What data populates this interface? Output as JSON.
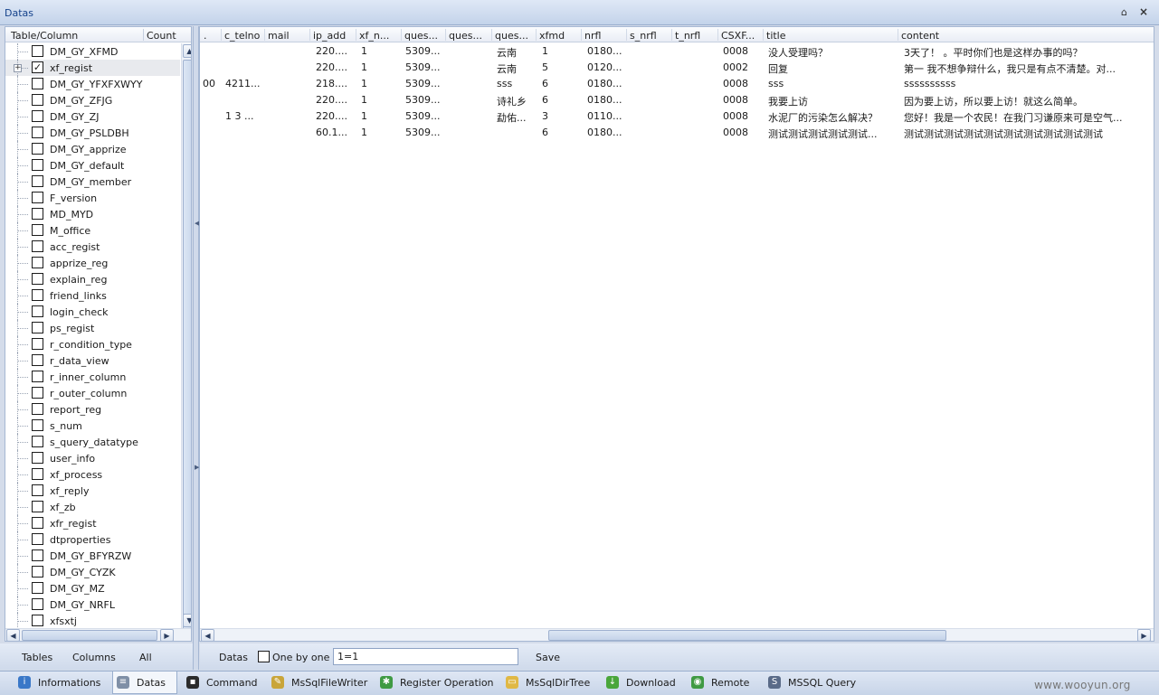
{
  "window": {
    "title": "Datas",
    "pin_glyph": "⌂",
    "close_glyph": "×"
  },
  "left_panel": {
    "headers": {
      "table_column": "Table/Column",
      "count": "Count"
    },
    "items": [
      {
        "label": "DM_GY_XFMD",
        "checked": false
      },
      {
        "label": "xf_regist",
        "checked": true,
        "expandable": true,
        "selected": true
      },
      {
        "label": "DM_GY_YFXFXWYY",
        "checked": false
      },
      {
        "label": "DM_GY_ZFJG",
        "checked": false
      },
      {
        "label": "DM_GY_ZJ",
        "checked": false
      },
      {
        "label": "DM_GY_PSLDBH",
        "checked": false
      },
      {
        "label": "DM_GY_apprize",
        "checked": false
      },
      {
        "label": "DM_GY_default",
        "checked": false
      },
      {
        "label": "DM_GY_member",
        "checked": false
      },
      {
        "label": "F_version",
        "checked": false
      },
      {
        "label": "MD_MYD",
        "checked": false
      },
      {
        "label": "M_office",
        "checked": false
      },
      {
        "label": "acc_regist",
        "checked": false
      },
      {
        "label": "apprize_reg",
        "checked": false
      },
      {
        "label": "explain_reg",
        "checked": false
      },
      {
        "label": "friend_links",
        "checked": false
      },
      {
        "label": "login_check",
        "checked": false
      },
      {
        "label": "ps_regist",
        "checked": false
      },
      {
        "label": "r_condition_type",
        "checked": false
      },
      {
        "label": "r_data_view",
        "checked": false
      },
      {
        "label": "r_inner_column",
        "checked": false
      },
      {
        "label": "r_outer_column",
        "checked": false
      },
      {
        "label": "report_reg",
        "checked": false
      },
      {
        "label": "s_num",
        "checked": false
      },
      {
        "label": "s_query_datatype",
        "checked": false
      },
      {
        "label": "user_info",
        "checked": false
      },
      {
        "label": "xf_process",
        "checked": false
      },
      {
        "label": "xf_reply",
        "checked": false
      },
      {
        "label": "xf_zb",
        "checked": false
      },
      {
        "label": "xfr_regist",
        "checked": false
      },
      {
        "label": "dtproperties",
        "checked": false
      },
      {
        "label": "DM_GY_BFYRZW",
        "checked": false
      },
      {
        "label": "DM_GY_CYZK",
        "checked": false
      },
      {
        "label": "DM_GY_MZ",
        "checked": false
      },
      {
        "label": "DM_GY_NRFL",
        "checked": false
      },
      {
        "label": "xfsxtj",
        "checked": false
      }
    ],
    "bottom": {
      "tables": "Tables",
      "columns": "Columns",
      "all": "All"
    }
  },
  "grid": {
    "columns": [
      ".",
      "c_telno",
      "mail",
      "ip_add",
      "xf_n...",
      "ques...",
      "ques...",
      "ques...",
      "xfmd",
      "nrfl",
      "s_nrfl",
      "t_nrfl",
      "CSXF...",
      "title",
      "content"
    ],
    "rows": [
      [
        "",
        "",
        "",
        "220....",
        "1",
        "5309...",
        "",
        "云南",
        "1",
        "0180...",
        "",
        "",
        "0008",
        "没人受理吗？",
        "3天了！ 。平时你们也是这样办事的吗？"
      ],
      [
        "",
        "",
        "",
        "220....",
        "1",
        "5309...",
        "",
        "云南",
        "5",
        "0120...",
        "",
        "",
        "0002",
        "回复",
        "第一 我不想争辩什么，我只是有点不清楚。对..."
      ],
      [
        "00",
        "4211...",
        "",
        "218....",
        "1",
        "5309...",
        "",
        "sss",
        "6",
        "0180...",
        "",
        "",
        "0008",
        "sss",
        "ssssssssss"
      ],
      [
        "",
        "",
        "",
        "220....",
        "1",
        "5309...",
        "",
        "诗礼乡",
        "6",
        "0180...",
        "",
        "",
        "0008",
        "我要上访",
        "因为要上访，所以要上访！就这么简单。"
      ],
      [
        "",
        "1 3 ...",
        "",
        "220....",
        "1",
        "5309...",
        "",
        "勐佑...",
        "3",
        "0110...",
        "",
        "",
        "0008",
        "水泥厂的污染怎么解决？",
        "您好！我是一个农民！在我门习谦原来可是空气..."
      ],
      [
        "",
        "",
        "",
        "60.1...",
        "1",
        "5309...",
        "",
        "",
        "6",
        "0180...",
        "",
        "",
        "0008",
        "测试测试测试测试测试...",
        "测试测试测试测试测试测试测试测试测试测试"
      ]
    ]
  },
  "bottom_bar": {
    "datas": "Datas",
    "one_by_one": "One by one",
    "condition_value": "1=1",
    "save": "Save"
  },
  "tabs": [
    {
      "label": "Informations",
      "icon": "info-icon",
      "color": "#3a78c8",
      "glyph": "i"
    },
    {
      "label": "Datas",
      "icon": "database-icon",
      "color": "#7f8fa6",
      "glyph": "≡",
      "active": true
    },
    {
      "label": "Command",
      "icon": "terminal-icon",
      "color": "#2b2b2b",
      "glyph": "▪"
    },
    {
      "label": "MsSqlFileWriter",
      "icon": "pencil-icon",
      "color": "#c9a53a",
      "glyph": "✎"
    },
    {
      "label": "Register Operation",
      "icon": "registry-icon",
      "color": "#3f9a43",
      "glyph": "✱"
    },
    {
      "label": "MsSqlDirTree",
      "icon": "folder-icon",
      "color": "#e0b845",
      "glyph": "▭"
    },
    {
      "label": "Download",
      "icon": "download-icon",
      "color": "#4aa63b",
      "glyph": "↓"
    },
    {
      "label": "Remote",
      "icon": "globe-icon",
      "color": "#3f9a43",
      "glyph": "◉"
    },
    {
      "label": "MSSQL Query",
      "icon": "sql-icon",
      "color": "#5a6b88",
      "glyph": "S"
    }
  ],
  "watermark": "www.wooyun.org"
}
